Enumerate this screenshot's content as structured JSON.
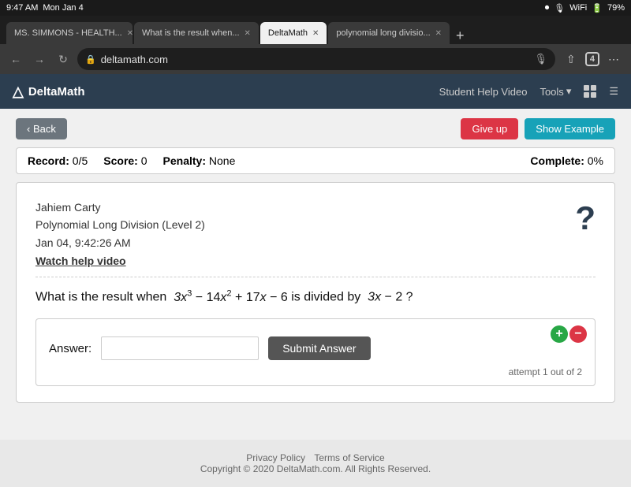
{
  "statusBar": {
    "time": "9:47 AM",
    "day": "Mon Jan 4",
    "battery": "79%"
  },
  "tabs": [
    {
      "id": "tab1",
      "label": "MS. SIMMONS - HEALTH...",
      "active": false
    },
    {
      "id": "tab2",
      "label": "What is the result when...",
      "active": false
    },
    {
      "id": "tab3",
      "label": "DeltaMath",
      "active": true
    },
    {
      "id": "tab4",
      "label": "polynomial long divisio...",
      "active": false
    }
  ],
  "addressBar": {
    "url": "deltamath.com"
  },
  "dmHeader": {
    "logo": "DeltaMath",
    "studentHelp": "Student Help Video",
    "tools": "Tools"
  },
  "buttons": {
    "back": "‹ Back",
    "giveUp": "Give up",
    "showExample": "Show Example"
  },
  "record": {
    "label": "Record:",
    "value": "0/5",
    "scoreLabel": "Score:",
    "scoreValue": "0",
    "penaltyLabel": "Penalty:",
    "penaltyValue": "None",
    "completeLabel": "Complete:",
    "completeValue": "0%"
  },
  "question": {
    "studentName": "Jahiem Carty",
    "topic": "Polynomial Long Division (Level 2)",
    "datetime": "Jan 04, 9:42:26 AM",
    "watchLink": "Watch help video",
    "questionText": "What is the result when",
    "expression": "3x³ − 14x² + 17x − 6",
    "dividedBy": "is divided by",
    "divisor": "3x − 2",
    "questionEnd": "?"
  },
  "answer": {
    "label": "Answer:",
    "placeholder": "",
    "submitLabel": "Submit Answer",
    "attemptText": "attempt 1 out of 2"
  },
  "footer": {
    "privacy": "Privacy Policy",
    "terms": "Terms of Service",
    "copyright": "Copyright © 2020 DeltaMath.com. All Rights Reserved."
  }
}
